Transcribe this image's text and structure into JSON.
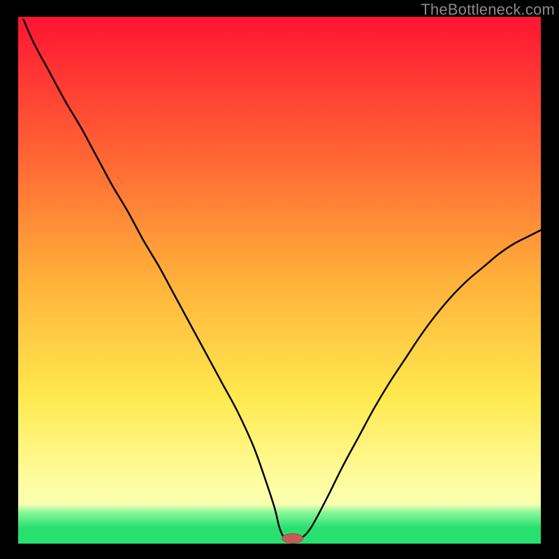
{
  "watermark": "TheBottleneck.com",
  "colors": {
    "black": "#000000",
    "curve": "#000000",
    "marker_fill": "#c85a5a",
    "marker_stroke": "#a04545",
    "grad_top": "#ff1433",
    "grad_q1": "#ff6a34",
    "grad_mid": "#ffb13a",
    "grad_q3": "#ffe94e",
    "grad_yellowband_top": "#fffb9a",
    "grad_yellowband_bot": "#faffb0",
    "grad_green_top": "#8cf79a",
    "grad_green_bot": "#28e070"
  },
  "chart_data": {
    "type": "line",
    "title": "",
    "xlabel": "",
    "ylabel": "",
    "xlim": [
      0,
      100
    ],
    "ylim": [
      0,
      100
    ],
    "x": [
      1,
      3,
      6,
      9,
      12,
      15,
      18,
      21,
      24,
      27,
      30,
      33,
      36,
      39,
      42,
      45,
      47,
      49,
      50,
      51,
      52,
      54,
      56,
      59,
      62,
      65,
      68,
      71,
      74,
      77,
      80,
      83,
      86,
      89,
      92,
      95,
      98,
      100
    ],
    "values": [
      99.5,
      95.0,
      89.5,
      84.0,
      79.0,
      73.5,
      68.0,
      63.0,
      57.5,
      52.5,
      47.0,
      41.5,
      36.0,
      30.5,
      25.0,
      18.5,
      13.0,
      7.0,
      3.0,
      1.0,
      1.0,
      1.0,
      3.0,
      8.5,
      14.5,
      20.0,
      25.5,
      30.5,
      35.0,
      39.5,
      43.5,
      47.0,
      50.0,
      52.5,
      55.0,
      57.0,
      58.5,
      59.5
    ],
    "marker": {
      "x": 52.5,
      "y": 1.0,
      "rx": 2.0,
      "ry": 0.9
    }
  }
}
